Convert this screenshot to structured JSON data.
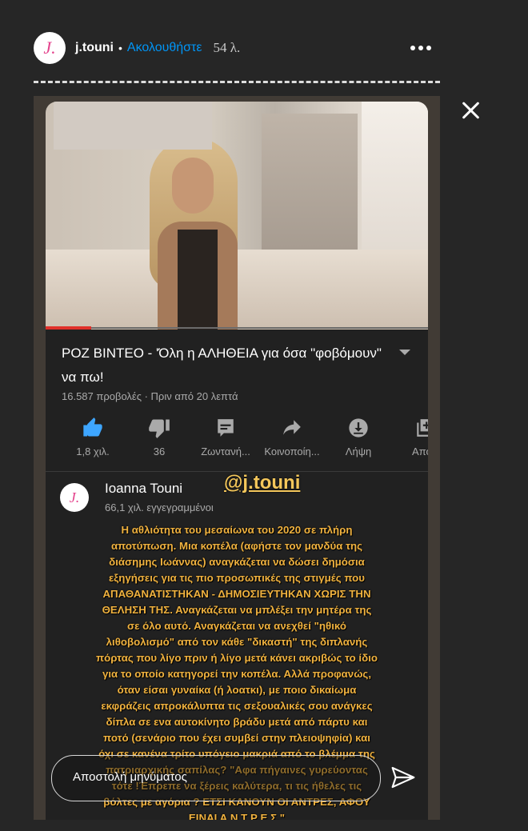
{
  "header": {
    "avatar_letter": "J.",
    "username": "j.touni",
    "separator": "•",
    "follow_label": "Ακολουθήστε",
    "time_ago": "54 λ."
  },
  "video": {
    "title": "ΡΟΖ ΒΙΝΤΕΟ - 'Όλη η ΑΛΗΘΕΙΑ για όσα \"φοβόμουν\" να πω!",
    "meta": "16.587 προβολές · Πριν από 20 λεπτά",
    "progress_fraction": 0.12
  },
  "actions": [
    {
      "icon": "thumbs-up-icon",
      "label": "1,8 χιλ."
    },
    {
      "icon": "thumbs-down-icon",
      "label": "36"
    },
    {
      "icon": "live-chat-icon",
      "label": "Ζωντανή..."
    },
    {
      "icon": "share-icon",
      "label": "Κοινοποίη..."
    },
    {
      "icon": "download-icon",
      "label": "Λήψη"
    },
    {
      "icon": "save-icon",
      "label": "Αποθ"
    }
  ],
  "channel": {
    "avatar_letter": "J.",
    "name": "Ioanna Touni",
    "subscribers": "66,1 χιλ. εγγεγραμμένοι"
  },
  "mention": "@j.touni",
  "description": "Η αθλιότητα του μεσαίωνα του 2020 σε πλήρη\nαποτύπωση. Μια κοπέλα (αφήστε τον μανδύα της\nδιάσημης Ιωάννας) αναγκάζεται να δώσει δημόσια\nεξηγήσεις για τις πιο προσωπικές της στιγμές που\nΑΠΑΘΑΝΑΤΙΣΤΗΚΑΝ - ΔΗΜΟΣΙΕΥΤΗΚΑΝ ΧΩΡΙΣ ΤΗΝ\nΘΕΛΗΣΗ ΤΗΣ. Αναγκάζεται να μπλέξει την μητέρα της\nσε όλο αυτό. Αναγκάζεται να ανεχθεί \"ηθικό\nλιθοβολισμό\" από τον κάθε \"δικαστή\" της διπλανής\nπόρτας που λίγο πριν ή λίγο μετά κάνει ακριβώς το ίδιο\nγια το οποίο κατηγορεί την κοπέλα. Αλλά προφανώς,\nόταν είσαι γυναίκα (ή λοατκι), με ποιο δικαίωμα\nεκφράζεις απροκάλυπτα τις σεξουαλικές σου ανάγκες\nδίπλα σε ενα αυτοκίνητο βράδυ μετά από πάρτυ και\nποτό (σενάριο που έχει συμβεί στην πλειοψηφία) και\nόχι σε κανένα τρίτο υπόγειο μακριά από το βλέμμα της\nπατριαρχικής σαπίλας? \"Αφα πήγαινες γυρεύοντας\nτότε !Έπρεπε να ξέρεις καλύτερα, τι τις ήθελες τις\nβόλτες με αγόρια ? ΕΤΣΙ ΚΑΝΟΥΝ ΟΙ ΑΝΤΡΕΣ, ΑΦΟΥ\nΕΙΝΑΙ Α Ν Τ Ρ Ε Σ.\"\n...",
  "message": {
    "placeholder": "Αποστολή μηνύματος"
  },
  "colors": {
    "background": "#262626",
    "follow": "#0095f6",
    "description": "#f0b23f",
    "like_active": "#3ea6ff"
  }
}
